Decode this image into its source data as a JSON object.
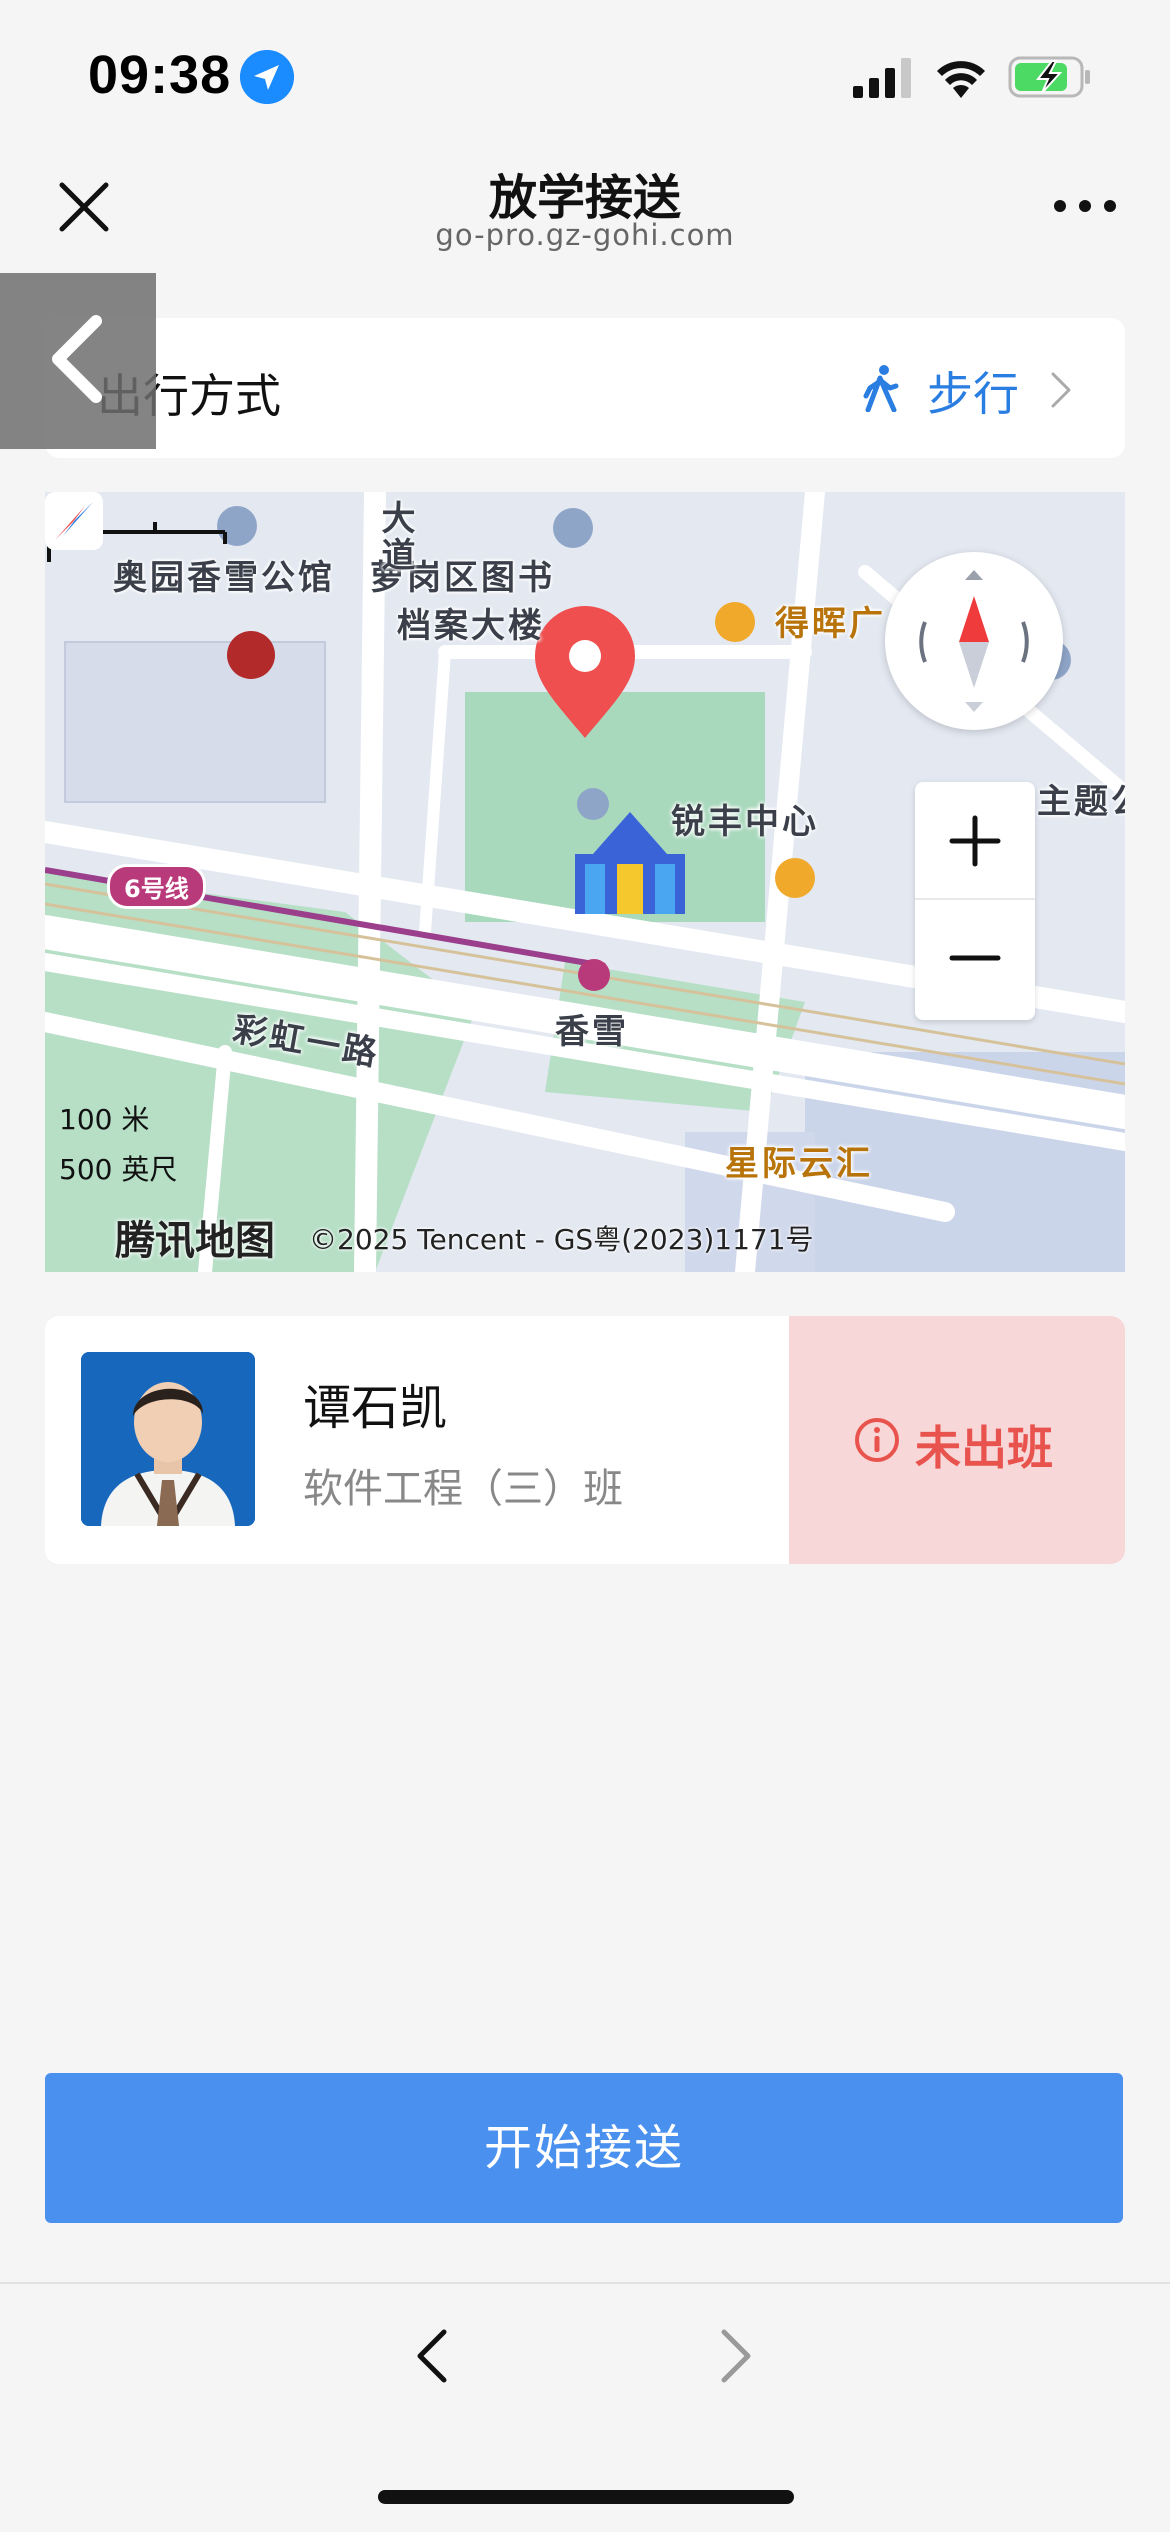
{
  "status_bar": {
    "time": "09:38",
    "icons": [
      "location-arrow-icon",
      "cellular-signal-icon",
      "wifi-icon",
      "battery-charging-icon"
    ],
    "battery_color": "#4cd964"
  },
  "nav": {
    "title": "放学接送",
    "url": "go-pro.gz-gohi.com",
    "close_icon": "close-icon",
    "more_icon": "more-icon"
  },
  "back_overlay_icon": "chevron-left-icon",
  "travel_mode": {
    "label": "出行方式",
    "value": "步行",
    "icon": "walking-person-icon",
    "accent": "#2a7de1"
  },
  "map": {
    "labels": {
      "park": "奥园香雪公馆",
      "library_line1": "萝岗区图书",
      "library_line2": "档案大楼",
      "road_vertical": "大道",
      "shop": "得晖广",
      "tower": "锐丰中心",
      "theme": "主题公",
      "metro_line": "6号线",
      "station": "香雪",
      "road": "彩虹一路",
      "mall": "星际云汇"
    },
    "scale_metric": "100 米",
    "scale_imperial": "500 英尺",
    "provider": "腾讯地图",
    "copyright": "©2025 Tencent - GS粤(2023)1171号"
  },
  "student": {
    "name": "谭石凯",
    "class_name": "软件工程（三）班",
    "status": "未出班",
    "status_color": "#e8534e",
    "status_bg": "#f8d7d8"
  },
  "start_button": {
    "label": "开始接送",
    "color": "#4a90ee"
  },
  "browser_bar": {
    "back_icon": "chevron-left-icon",
    "forward_icon": "chevron-right-icon"
  }
}
